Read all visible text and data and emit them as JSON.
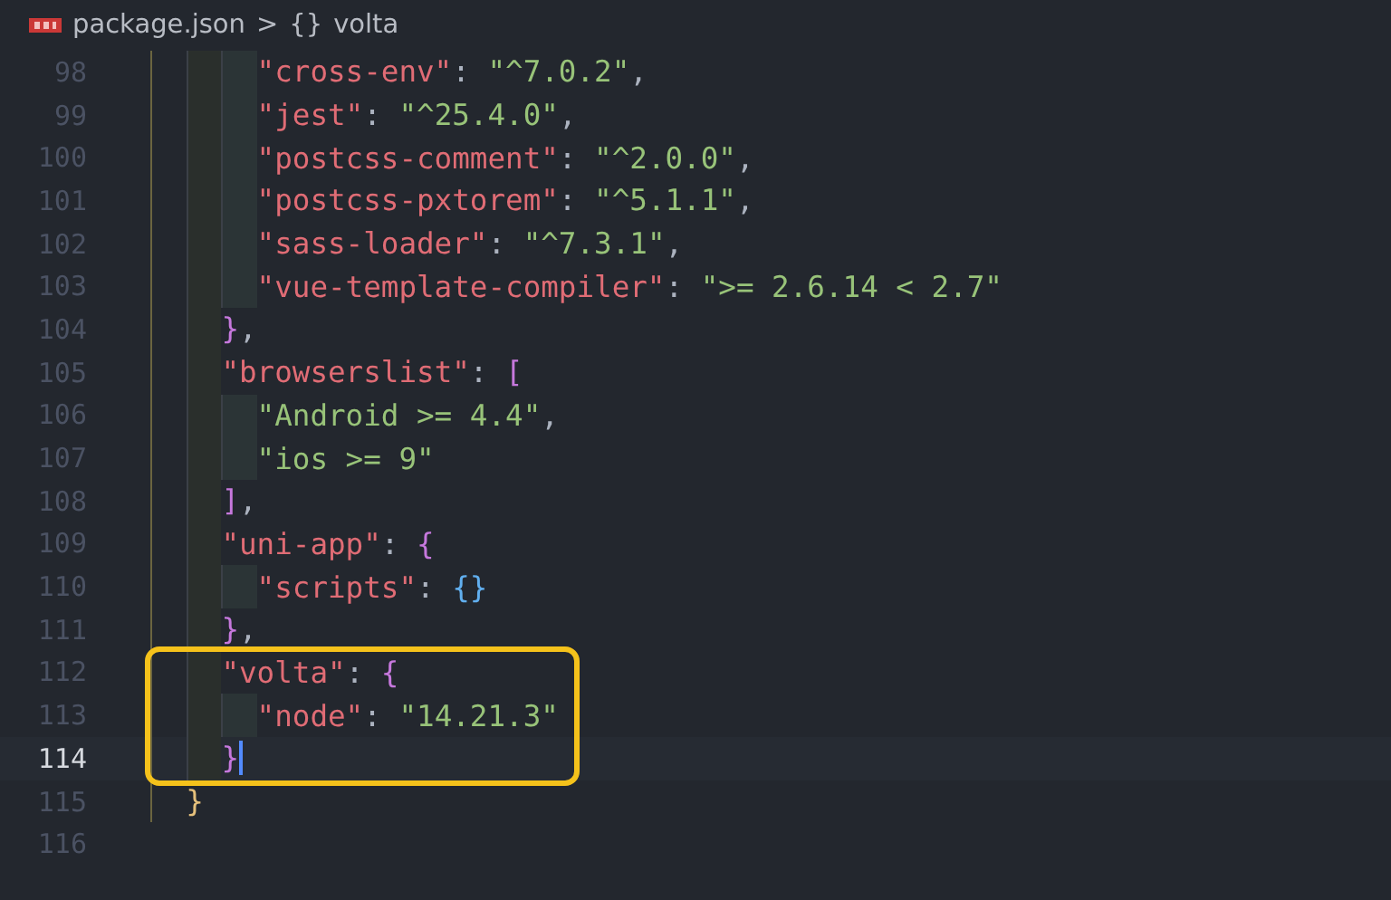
{
  "breadcrumb": {
    "file": "package.json",
    "separator": ">",
    "symbol_glyph": "{}",
    "symbol": "volta"
  },
  "lines": [
    {
      "number": "98",
      "guides": [
        {
          "kind": "outer"
        },
        {
          "kind": "mid"
        },
        {
          "kind": "inner"
        }
      ],
      "current": false,
      "boxed": false,
      "tokens": [
        {
          "kind": "key",
          "text": "\"cross-env\""
        },
        {
          "kind": "punct",
          "text": ": "
        },
        {
          "kind": "string",
          "text": "\"^7.0.2\""
        },
        {
          "kind": "punct",
          "text": ","
        }
      ]
    },
    {
      "number": "99",
      "guides": [
        {
          "kind": "outer"
        },
        {
          "kind": "mid"
        },
        {
          "kind": "inner"
        }
      ],
      "current": false,
      "boxed": false,
      "tokens": [
        {
          "kind": "key",
          "text": "\"jest\""
        },
        {
          "kind": "punct",
          "text": ": "
        },
        {
          "kind": "string",
          "text": "\"^25.4.0\""
        },
        {
          "kind": "punct",
          "text": ","
        }
      ]
    },
    {
      "number": "100",
      "guides": [
        {
          "kind": "outer"
        },
        {
          "kind": "mid"
        },
        {
          "kind": "inner"
        }
      ],
      "current": false,
      "boxed": false,
      "tokens": [
        {
          "kind": "key",
          "text": "\"postcss-comment\""
        },
        {
          "kind": "punct",
          "text": ": "
        },
        {
          "kind": "string",
          "text": "\"^2.0.0\""
        },
        {
          "kind": "punct",
          "text": ","
        }
      ]
    },
    {
      "number": "101",
      "guides": [
        {
          "kind": "outer"
        },
        {
          "kind": "mid"
        },
        {
          "kind": "inner"
        }
      ],
      "current": false,
      "boxed": false,
      "tokens": [
        {
          "kind": "key",
          "text": "\"postcss-pxtorem\""
        },
        {
          "kind": "punct",
          "text": ": "
        },
        {
          "kind": "string",
          "text": "\"^5.1.1\""
        },
        {
          "kind": "punct",
          "text": ","
        }
      ]
    },
    {
      "number": "102",
      "guides": [
        {
          "kind": "outer"
        },
        {
          "kind": "mid"
        },
        {
          "kind": "inner"
        }
      ],
      "current": false,
      "boxed": false,
      "tokens": [
        {
          "kind": "key",
          "text": "\"sass-loader\""
        },
        {
          "kind": "punct",
          "text": ": "
        },
        {
          "kind": "string",
          "text": "\"^7.3.1\""
        },
        {
          "kind": "punct",
          "text": ","
        }
      ]
    },
    {
      "number": "103",
      "guides": [
        {
          "kind": "outer"
        },
        {
          "kind": "mid"
        },
        {
          "kind": "inner"
        }
      ],
      "current": false,
      "boxed": false,
      "tokens": [
        {
          "kind": "key",
          "text": "\"vue-template-compiler\""
        },
        {
          "kind": "punct",
          "text": ": "
        },
        {
          "kind": "string",
          "text": "\">= 2.6.14 < 2.7\""
        }
      ]
    },
    {
      "number": "104",
      "guides": [
        {
          "kind": "outer"
        },
        {
          "kind": "mid"
        }
      ],
      "current": false,
      "boxed": false,
      "tokens": [
        {
          "kind": "brace2",
          "text": "}"
        },
        {
          "kind": "punct",
          "text": ","
        }
      ]
    },
    {
      "number": "105",
      "guides": [
        {
          "kind": "outer"
        },
        {
          "kind": "mid"
        }
      ],
      "current": false,
      "boxed": false,
      "tokens": [
        {
          "kind": "key",
          "text": "\"browserslist\""
        },
        {
          "kind": "punct",
          "text": ": "
        },
        {
          "kind": "brace2",
          "text": "["
        }
      ]
    },
    {
      "number": "106",
      "guides": [
        {
          "kind": "outer"
        },
        {
          "kind": "mid"
        },
        {
          "kind": "inner"
        }
      ],
      "current": false,
      "boxed": false,
      "tokens": [
        {
          "kind": "string",
          "text": "\"Android >= 4.4\""
        },
        {
          "kind": "punct",
          "text": ","
        }
      ]
    },
    {
      "number": "107",
      "guides": [
        {
          "kind": "outer"
        },
        {
          "kind": "mid"
        },
        {
          "kind": "inner"
        }
      ],
      "current": false,
      "boxed": false,
      "tokens": [
        {
          "kind": "string",
          "text": "\"ios >= 9\""
        }
      ]
    },
    {
      "number": "108",
      "guides": [
        {
          "kind": "outer"
        },
        {
          "kind": "mid"
        }
      ],
      "current": false,
      "boxed": false,
      "tokens": [
        {
          "kind": "brace2",
          "text": "]"
        },
        {
          "kind": "punct",
          "text": ","
        }
      ]
    },
    {
      "number": "109",
      "guides": [
        {
          "kind": "outer"
        },
        {
          "kind": "mid"
        }
      ],
      "current": false,
      "boxed": false,
      "tokens": [
        {
          "kind": "key",
          "text": "\"uni-app\""
        },
        {
          "kind": "punct",
          "text": ": "
        },
        {
          "kind": "brace2",
          "text": "{"
        }
      ]
    },
    {
      "number": "110",
      "guides": [
        {
          "kind": "outer"
        },
        {
          "kind": "mid"
        },
        {
          "kind": "inner"
        }
      ],
      "current": false,
      "boxed": false,
      "tokens": [
        {
          "kind": "key",
          "text": "\"scripts\""
        },
        {
          "kind": "punct",
          "text": ": "
        },
        {
          "kind": "brace3",
          "text": "{}"
        }
      ]
    },
    {
      "number": "111",
      "guides": [
        {
          "kind": "outer"
        },
        {
          "kind": "mid"
        }
      ],
      "current": false,
      "boxed": false,
      "tokens": [
        {
          "kind": "brace2",
          "text": "}"
        },
        {
          "kind": "punct",
          "text": ","
        }
      ]
    },
    {
      "number": "112",
      "guides": [
        {
          "kind": "outer"
        },
        {
          "kind": "mid"
        }
      ],
      "current": false,
      "boxed": true,
      "tokens": [
        {
          "kind": "key",
          "text": "\"volta\""
        },
        {
          "kind": "punct",
          "text": ": "
        },
        {
          "kind": "brace2",
          "text": "{"
        }
      ]
    },
    {
      "number": "113",
      "guides": [
        {
          "kind": "outer"
        },
        {
          "kind": "mid"
        },
        {
          "kind": "inner"
        }
      ],
      "current": false,
      "boxed": true,
      "tokens": [
        {
          "kind": "key",
          "text": "\"node\""
        },
        {
          "kind": "punct",
          "text": ": "
        },
        {
          "kind": "string",
          "text": "\"14.21.3\""
        }
      ]
    },
    {
      "number": "114",
      "guides": [
        {
          "kind": "outer"
        },
        {
          "kind": "mid"
        }
      ],
      "current": true,
      "boxed": true,
      "tokens": [
        {
          "kind": "brace2",
          "text": "}"
        }
      ]
    },
    {
      "number": "115",
      "guides": [
        {
          "kind": "outer"
        }
      ],
      "current": false,
      "boxed": false,
      "tokens": [
        {
          "kind": "brace1",
          "text": "}"
        }
      ]
    },
    {
      "number": "116",
      "current": false,
      "boxed": false
    }
  ]
}
